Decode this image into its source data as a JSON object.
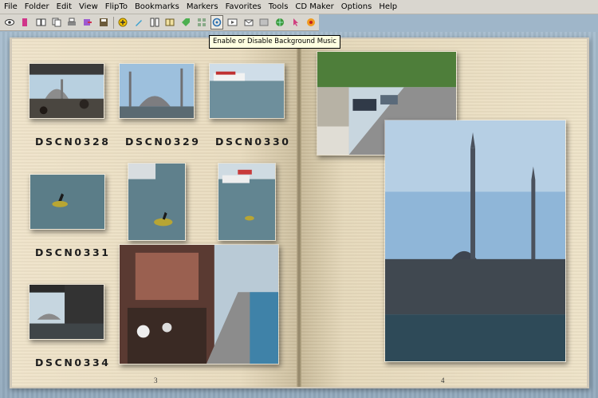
{
  "menu": [
    "File",
    "Folder",
    "Edit",
    "View",
    "FlipTo",
    "Bookmarks",
    "Markers",
    "Favorites",
    "Tools",
    "CD Maker",
    "Options",
    "Help"
  ],
  "toolbar_icons": [
    "eye-icon",
    "bookmark-icon",
    "open-book-icon",
    "copy-icon",
    "print-icon",
    "export-icon",
    "save-icon",
    "add-marker-icon",
    "marker-pen-icon",
    "columns-icon",
    "two-page-icon",
    "tag-icon",
    "thumbnail-view-icon",
    "music-toggle-icon",
    "slideshow-icon",
    "email-icon",
    "photo-icon",
    "web-icon",
    "pointer-icon",
    "record-icon"
  ],
  "tooltip": "Enable or Disable Background Music",
  "left_page": {
    "number": "3",
    "captions": [
      "DSCN0328",
      "DSCN0329",
      "DSCN0330",
      "DSCN0331",
      "DSCN0334"
    ]
  },
  "right_page": {
    "number": "4"
  },
  "colors": {
    "menubar_bg": "#d9d6cf",
    "desk_bg": "#9fb6c9",
    "paper": "#eee3c8",
    "tooltip_bg": "#ffffe1"
  }
}
